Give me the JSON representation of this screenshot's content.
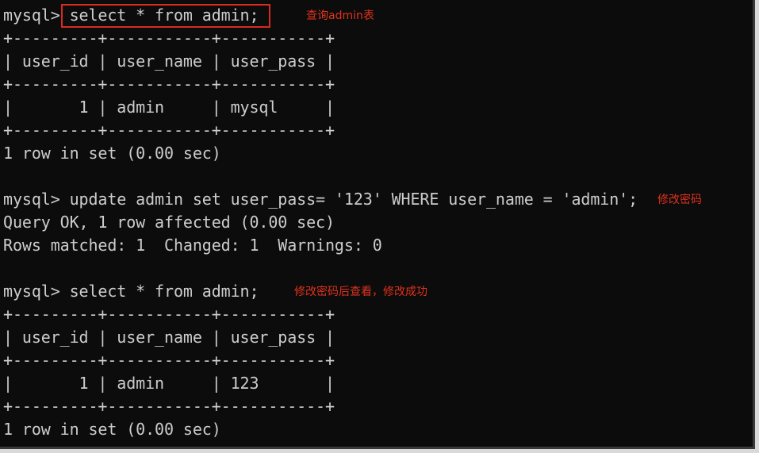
{
  "terminal": {
    "lines": [
      "mysql> select * from admin;",
      "+---------+-----------+-----------+",
      "| user_id | user_name | user_pass |",
      "+---------+-----------+-----------+",
      "|       1 | admin     | mysql     |",
      "+---------+-----------+-----------+",
      "1 row in set (0.00 sec)",
      "",
      "mysql> update admin set user_pass= '123' WHERE user_name = 'admin';",
      "Query OK, 1 row affected (0.00 sec)",
      "Rows matched: 1  Changed: 1  Warnings: 0",
      "",
      "mysql> select * from admin;",
      "+---------+-----------+-----------+",
      "| user_id | user_name | user_pass |",
      "+---------+-----------+-----------+",
      "|       1 | admin     | 123       |",
      "+---------+-----------+-----------+",
      "1 row in set (0.00 sec)"
    ]
  },
  "annotations": {
    "query_admin": "查询admin表",
    "change_password": "修改密码",
    "verify_success": "修改密码后查看，修改成功"
  },
  "colors": {
    "background": "#0c0c0c",
    "text": "#cccccc",
    "annotation": "#e0321c"
  }
}
